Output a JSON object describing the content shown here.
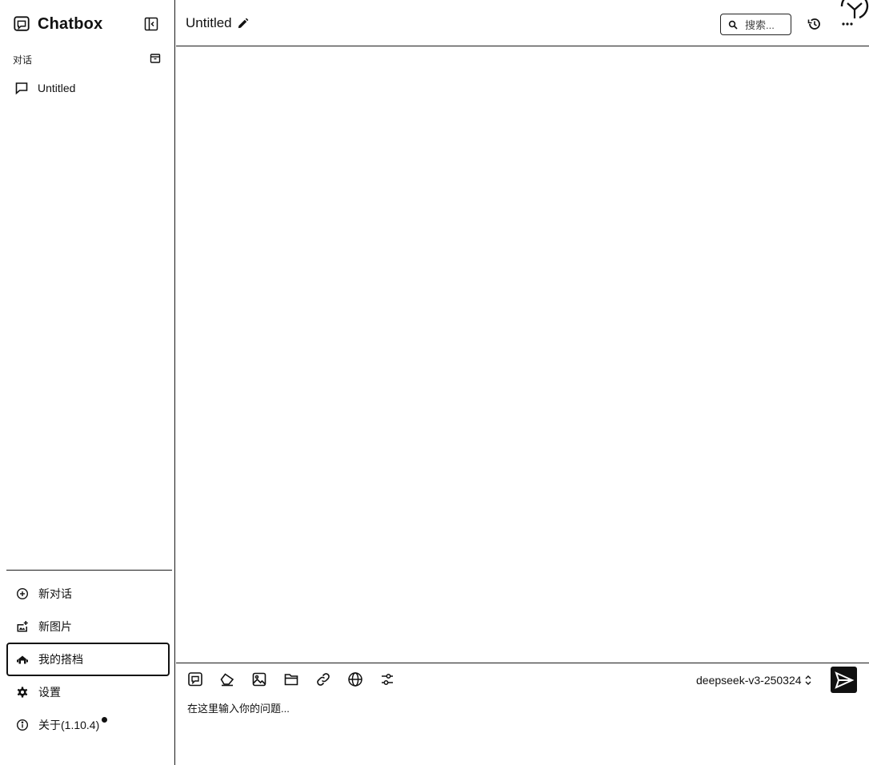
{
  "app": {
    "name": "Chatbox"
  },
  "sidebar": {
    "section_label": "对话",
    "sessions": [
      {
        "label": "Untitled"
      }
    ],
    "nav": [
      {
        "label": "新对话",
        "icon": "add-circle-icon"
      },
      {
        "label": "新图片",
        "icon": "add-image-icon"
      },
      {
        "label": "我的搭档",
        "icon": "copilot-icon",
        "active": true
      },
      {
        "label": "设置",
        "icon": "gear-icon"
      },
      {
        "label": "关于(1.10.4)",
        "icon": "info-icon",
        "badge": "update-dot"
      }
    ]
  },
  "header": {
    "title": "Untitled",
    "search_placeholder": "搜索..."
  },
  "input": {
    "toolbar_icons": [
      "chatbox-icon",
      "eraser-icon",
      "image-icon",
      "folder-icon",
      "link-icon",
      "globe-icon",
      "sliders-icon"
    ],
    "model": "deepseek-v3-250324",
    "placeholder": "在这里输入你的问题..."
  },
  "colors": {
    "foreground": "#111111",
    "background": "#ffffff",
    "border": "#1a1a1a"
  }
}
